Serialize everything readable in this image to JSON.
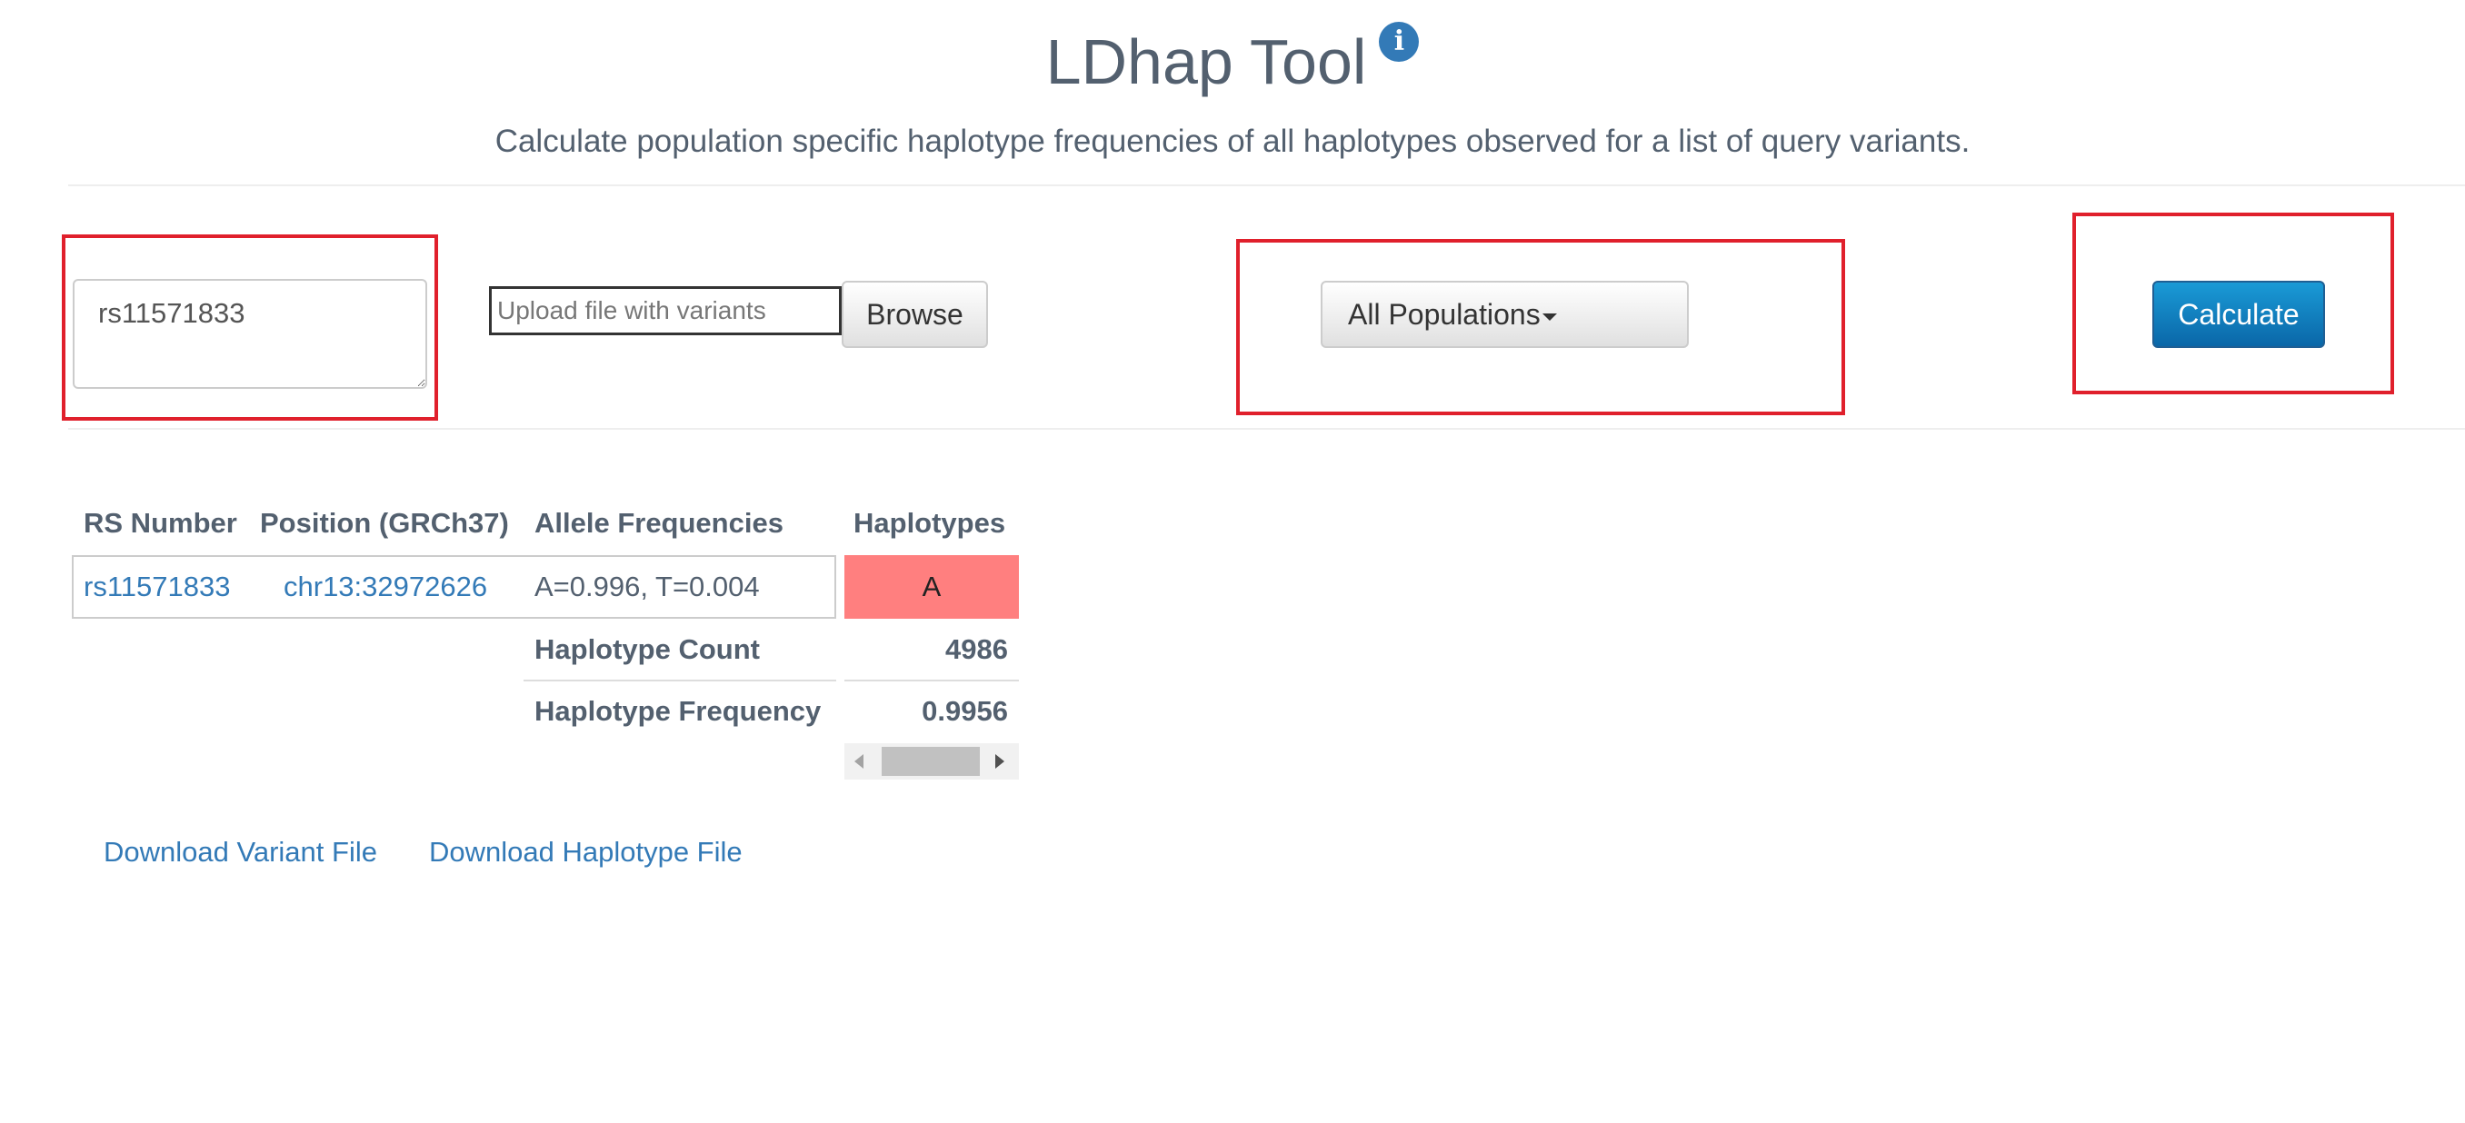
{
  "header": {
    "title": "LDhap Tool",
    "info_icon": "info-circle",
    "subtitle": "Calculate population specific haplotype frequencies of all haplotypes observed for a list of query variants."
  },
  "controls": {
    "variant_input_value": "rs11571833",
    "file_upload_placeholder": "Upload file with variants",
    "browse_label": "Browse",
    "population_selected": "All Populations",
    "calculate_label": "Calculate"
  },
  "results": {
    "columns": [
      "RS Number",
      "Position (GRCh37)",
      "Allele Frequencies",
      "Haplotypes"
    ],
    "variants": [
      {
        "rs": "rs11571833",
        "position": "chr13:32972626",
        "allele_freq": "A=0.996, T=0.004",
        "haplotype_allele": "A"
      }
    ],
    "haplotype_count_label": "Haplotype Count",
    "haplotype_count": "4986",
    "haplotype_frequency_label": "Haplotype Frequency",
    "haplotype_frequency": "0.9956"
  },
  "downloads": {
    "variant_file": "Download Variant File",
    "haplotype_file": "Download Haplotype File"
  },
  "colors": {
    "accent": "#337ab7",
    "calculate_button": "#0a77bd",
    "haplotype_cell": "#ff7f7f",
    "highlight_box": "#e0202c"
  }
}
